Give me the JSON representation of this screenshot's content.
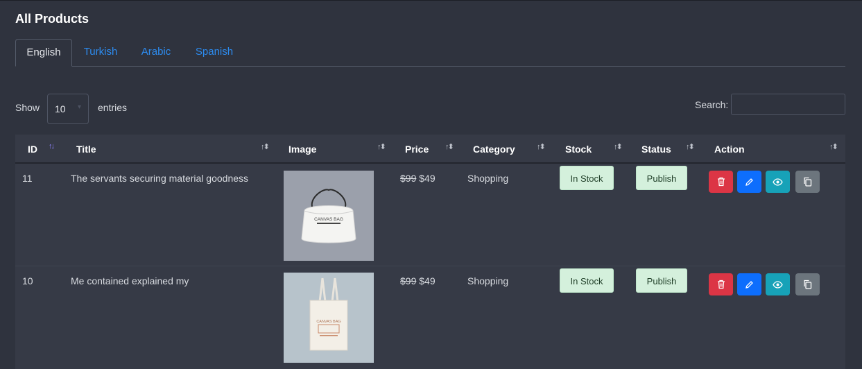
{
  "page": {
    "title": "All Products"
  },
  "tabs": [
    {
      "label": "English",
      "active": true
    },
    {
      "label": "Turkish",
      "active": false
    },
    {
      "label": "Arabic",
      "active": false
    },
    {
      "label": "Spanish",
      "active": false
    }
  ],
  "controls": {
    "show_label": "Show",
    "page_length": "10",
    "entries_label": "entries",
    "search_label": "Search:",
    "search_value": ""
  },
  "table": {
    "columns": [
      "ID",
      "Title",
      "Image",
      "Price",
      "Category",
      "Stock",
      "Status",
      "Action"
    ],
    "rows": [
      {
        "id": "11",
        "title": "The servants securing material goodness",
        "image_icon": "canvas-drawstring-bag-image",
        "image_text": "CANVAS BAG",
        "old_price": "$99",
        "price": "$49",
        "category": "Shopping",
        "stock": "In Stock",
        "status": "Publish"
      },
      {
        "id": "10",
        "title": "Me contained explained my",
        "image_icon": "canvas-tote-bag-image",
        "image_text": "CANVAS BAG",
        "old_price": "$99",
        "price": "$49",
        "category": "Shopping",
        "stock": "In Stock",
        "status": "Publish"
      }
    ]
  },
  "actions": {
    "delete_icon": "trash-icon",
    "edit_icon": "pencil-icon",
    "view_icon": "eye-icon",
    "copy_icon": "copy-icon"
  },
  "colors": {
    "background": "#2f333e",
    "table_background": "#363a46",
    "tab_link": "#2d8cf0",
    "badge_background": "#d4f0dc",
    "delete": "#dc3545",
    "edit": "#0d6efd",
    "view": "#17a2b8",
    "copy": "#6c757d"
  }
}
